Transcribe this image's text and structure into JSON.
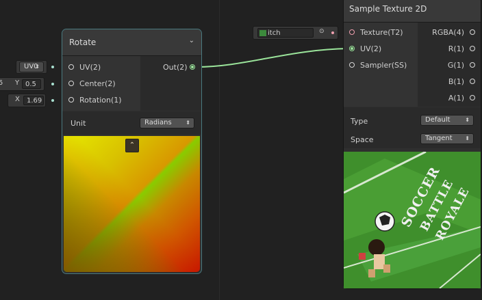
{
  "rotate_node": {
    "title": "Rotate",
    "inputs": [
      {
        "label": "UV(2)"
      },
      {
        "label": "Center(2)"
      },
      {
        "label": "Rotation(1)"
      }
    ],
    "outputs": [
      {
        "label": "Out(2)"
      }
    ],
    "unit_label": "Unit",
    "unit_value": "Radians"
  },
  "inline_fields": {
    "uv_channel": "UV0",
    "center_y_label": "Y",
    "center_y_value": "0.5",
    "center_x_partial": "5",
    "rotation_x_label": "X",
    "rotation_value": "1.69"
  },
  "texture_input_field": {
    "value": "itch"
  },
  "sample_texture_node": {
    "title": "Sample Texture 2D",
    "inputs": [
      {
        "label": "Texture(T2)"
      },
      {
        "label": "UV(2)"
      },
      {
        "label": "Sampler(SS)"
      }
    ],
    "outputs": [
      {
        "label": "RGBA(4)"
      },
      {
        "label": "R(1)"
      },
      {
        "label": "G(1)"
      },
      {
        "label": "B(1)"
      },
      {
        "label": "A(1)"
      }
    ],
    "type_label": "Type",
    "type_value": "Default",
    "space_label": "Space",
    "space_value": "Tangent"
  },
  "texture_preview_text": [
    "SOCCER",
    "BATTLE",
    "ROYALE"
  ],
  "colors": {
    "background": "#212121",
    "node_body": "#2f2f2f",
    "node_header": "#393939",
    "edge_green": "#9be59b",
    "texture_pink": "#f0a0b0"
  }
}
